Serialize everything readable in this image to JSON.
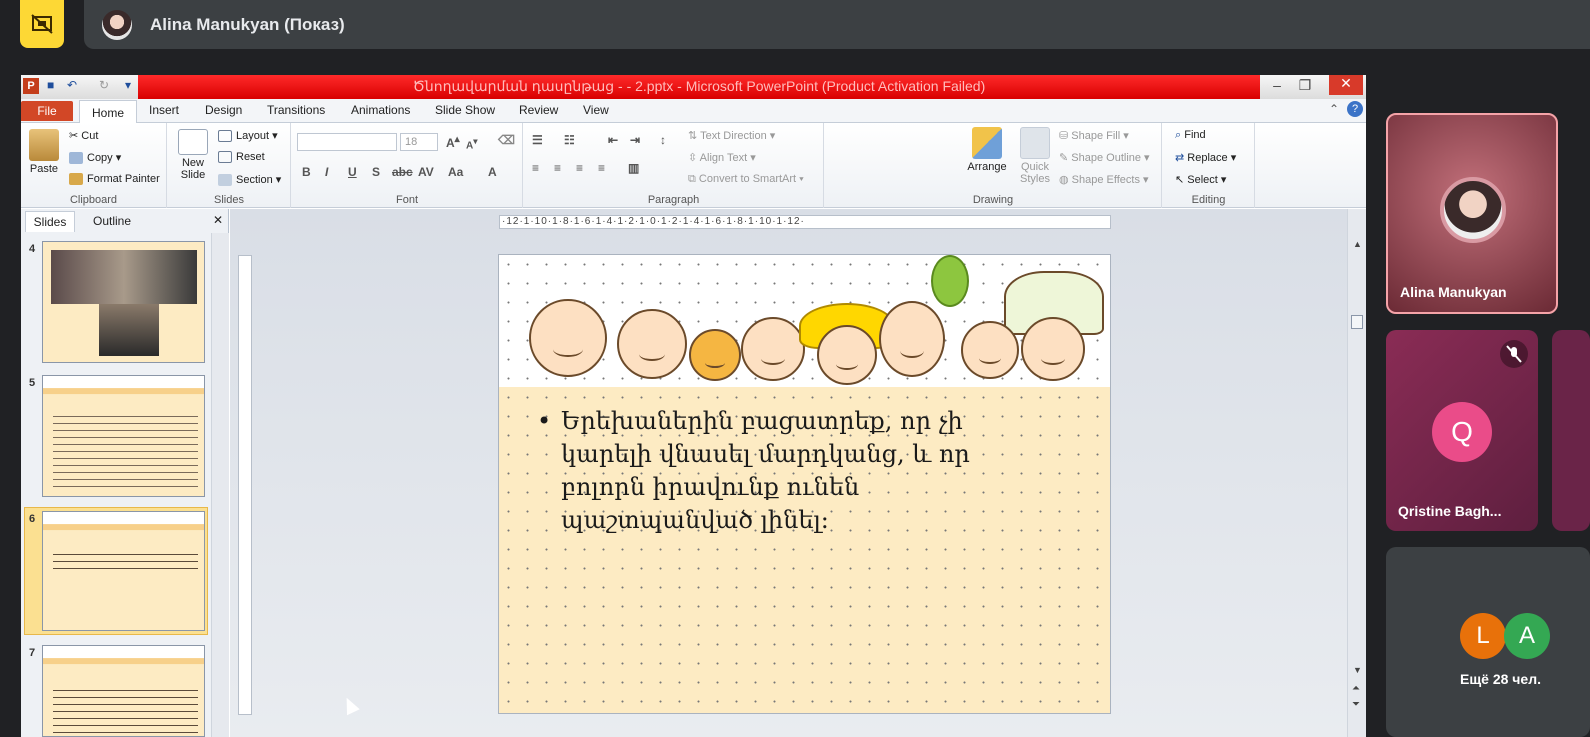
{
  "meet": {
    "presenter_label": "Alina Manukyan (Показ)",
    "self_tile_name": "Alina Manukyan",
    "participant_tile_name": "Qristine Bagh...",
    "participant_initial": "Q",
    "more_initials": [
      "L",
      "A"
    ],
    "more_count_label": "Ещё 28 чел."
  },
  "ppt": {
    "window_title": "Ծնողավարման դասընթաց - - 2.pptx - Microsoft PowerPoint (Product Activation Failed)",
    "app_icon": "P",
    "tabs": [
      "File",
      "Home",
      "Insert",
      "Design",
      "Transitions",
      "Animations",
      "Slide Show",
      "Review",
      "View"
    ],
    "clipboard": {
      "paste": "Paste",
      "cut": "Cut",
      "copy": "Copy",
      "format_painter": "Format Painter",
      "label": "Clipboard"
    },
    "slides_group": {
      "new_slide": "New Slide",
      "layout": "Layout",
      "reset": "Reset",
      "section": "Section",
      "label": "Slides"
    },
    "font_group": {
      "font_size": "18",
      "label": "Font"
    },
    "paragraph_group": {
      "text_direction": "Text Direction",
      "align_text": "Align Text",
      "convert": "Convert to SmartArt",
      "label": "Paragraph"
    },
    "drawing_group": {
      "arrange": "Arrange",
      "quick_styles": "Quick Styles",
      "shape_fill": "Shape Fill",
      "shape_outline": "Shape Outline",
      "shape_effects": "Shape Effects",
      "label": "Drawing"
    },
    "editing_group": {
      "find": "Find",
      "replace": "Replace",
      "select": "Select",
      "label": "Editing"
    },
    "pane_tabs": [
      "Slides",
      "Outline"
    ],
    "ruler_text": "·12·1·10·1·8·1·6·1·4·1·2·1·0·1·2·1·4·1·6·1·8·1·10·1·12·",
    "thumb_numbers": [
      "4",
      "5",
      "6",
      "7"
    ],
    "slide_bullet": "Երեխաներին բացատրեք, որ չի կարելի վնասել մարդկանց, և որ բոլորն իրավունք ունեն պաշտպանված լինել։"
  }
}
